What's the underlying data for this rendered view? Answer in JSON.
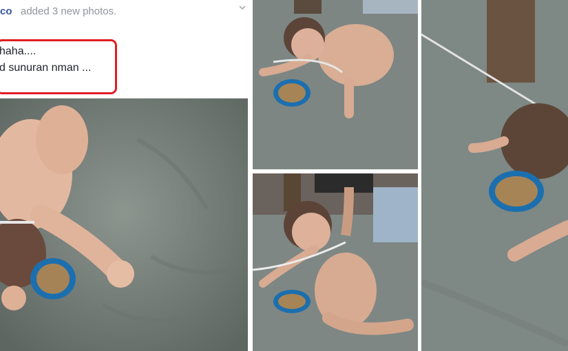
{
  "post": {
    "author_partial": "co",
    "action": "added 3 new photos.",
    "text_lines": [
      "haha....",
      "d sunuran nman ..."
    ],
    "menu_icon": "chevron-down-icon"
  },
  "photos": [
    {
      "name": "main-photo",
      "icon": "photo"
    },
    {
      "name": "top-middle-photo",
      "icon": "photo"
    },
    {
      "name": "bottom-middle-photo",
      "icon": "photo"
    },
    {
      "name": "right-photo",
      "icon": "photo"
    }
  ],
  "colors": {
    "highlight_border": "#e01c24",
    "author_link": "#365899",
    "meta_text": "#90949c"
  }
}
